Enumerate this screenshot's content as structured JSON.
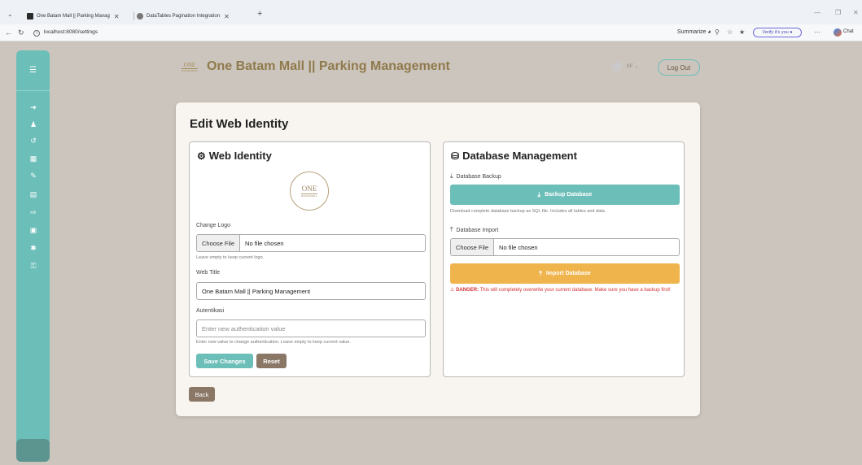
{
  "browser": {
    "tabs": [
      {
        "title": "One Batam Mall || Parking Manag"
      },
      {
        "title": "DataTables Pagination Integration"
      }
    ],
    "url": "localhost:8080/settings",
    "summarize_label": "Summarize",
    "verify_label": "Verify it's you",
    "chat_label": "Chat"
  },
  "sidebar": {
    "icons": [
      "menu-icon",
      "sign-in-icon",
      "users-icon",
      "history-icon",
      "table-icon",
      "edit-icon",
      "report-icon",
      "sign-out-icon",
      "box-icon",
      "gear-icon",
      "key-icon"
    ]
  },
  "header": {
    "logo_text": "ONE",
    "logo_subtext": "BATAM MALL",
    "title": "One Batam Mall || Parking Management",
    "user_initials": "KF",
    "logout_label": "Log Out"
  },
  "page": {
    "title": "Edit Web Identity",
    "back_label": "Back"
  },
  "web_identity": {
    "title": "Web Identity",
    "logo_text": "ONE",
    "logo_subtext": "BATAM MALL",
    "change_logo_label": "Change Logo",
    "file_button": "Choose File",
    "file_value": "No file chosen",
    "logo_help": "Leave empty to keep current logo.",
    "web_title_label": "Web Title",
    "web_title_value": "One Batam Mall || Parking Management",
    "auth_label": "Autentikasi",
    "auth_placeholder": "Enter new authentication value",
    "auth_help": "Enter new value to change authentication. Leave empty to keep current value.",
    "save_label": "Save Changes",
    "reset_label": "Reset"
  },
  "database": {
    "title": "Database Management",
    "backup_label": "Database Backup",
    "backup_button": "Backup Database",
    "backup_help": "Download complete database backup as SQL file. Includes all tables and data.",
    "import_label": "Database Import",
    "file_button": "Choose File",
    "file_value": "No file chosen",
    "import_button": "Import Database",
    "danger_prefix": "DANGER:",
    "danger_text": "This will completely overwrite your current database. Make sure you have a backup first!"
  },
  "colors": {
    "teal": "#6cbeb8",
    "brown": "#8a7766",
    "gold": "#8f7a4c",
    "warning": "#f0b44d",
    "danger": "#d32f2f"
  }
}
